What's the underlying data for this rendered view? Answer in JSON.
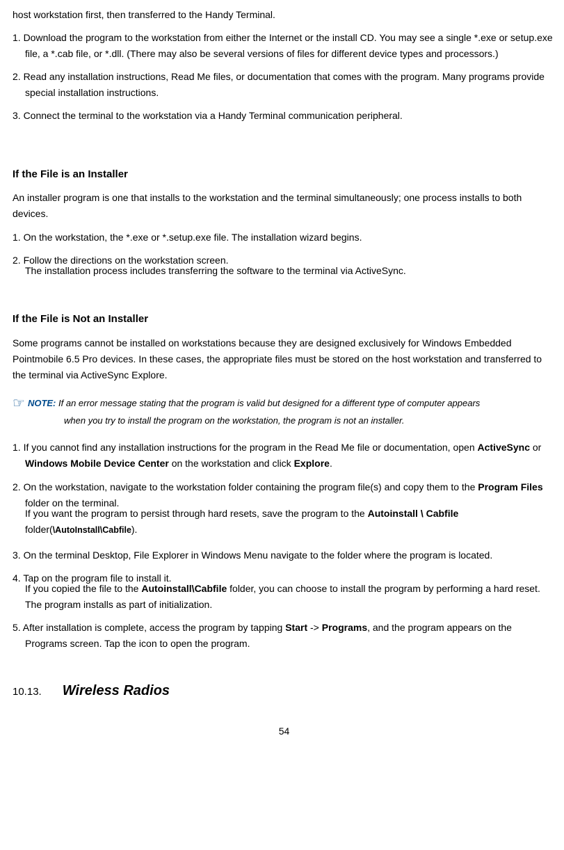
{
  "intro": {
    "p0": "host workstation first, then transferred to the Handy Terminal.",
    "li1": "1. Download the program to the workstation from either the Internet or the install CD. You may see a single *.exe or setup.exe file, a *.cab file, or *.dll. (There may also be several versions of files for different device types and processors.)",
    "li2": "2. Read any installation instructions, Read Me files, or documentation that comes with the program. Many programs provide special installation instructions.",
    "li3": "3. Connect the terminal to the workstation via a Handy Terminal communication peripheral."
  },
  "installer": {
    "heading": "If the File is an Installer",
    "p1": "An installer program is one that installs to the workstation and the terminal simultaneously; one process installs to both devices.",
    "li1": "1. On the workstation, the *.exe or *.setup.exe file. The installation wizard begins.",
    "li2a": "2. Follow the directions on the workstation screen.",
    "li2b": "The installation process includes transferring the software to the terminal via ActiveSync."
  },
  "notinstaller": {
    "heading": "If the File is Not an Installer",
    "p1": "Some programs cannot be installed on workstations because they are designed exclusively for Windows Embedded Pointmobile 6.5 Pro devices. In these cases, the appropriate files must be stored on the host workstation and transferred to the terminal via ActiveSync Explore."
  },
  "note": {
    "label": "NOTE:",
    "line1": " If an error message stating that the program is valid but designed for a different type of computer appears",
    "line2": "when you try to install the program on the workstation, the program is not an installer."
  },
  "steps": {
    "s1a": "1. If you cannot find any installation instructions for the program in the Read Me file or documentation, open ",
    "s1b": "ActiveSync",
    "s1c": " or ",
    "s1d": "Windows Mobile Device Center",
    "s1e": " on the workstation and click ",
    "s1f": "Explore",
    "s1g": ".",
    "s2a": "2. On the workstation, navigate to the workstation folder containing the program file(s) and copy them to the ",
    "s2b": "Program Files",
    "s2c": " folder on the terminal.",
    "s2d": "If you want the program to persist through hard resets, save the program to the ",
    "s2e": "Autoinstall \\ Cabfile",
    "s2f": " folder(",
    "s2g": "\\AutoInstall\\Cabfile",
    "s2h": ").",
    "s3": "3. On the terminal Desktop, File Explorer in Windows Menu navigate to the folder where the program is located.",
    "s4a": "4. Tap on the program file to install it.",
    "s4b": "If you copied the file to the ",
    "s4c": "Autoinstall\\Cabfile",
    "s4d": " folder, you can choose to install the program by performing a hard reset. The program installs as part of initialization.",
    "s5a": "5. After installation is complete, access the program by tapping ",
    "s5b": "Start",
    "s5c": " -> ",
    "s5d": "Programs",
    "s5e": ", and the program appears on the Programs screen. Tap the icon to open the program."
  },
  "section": {
    "number": "10.13.",
    "title": "Wireless Radios"
  },
  "page_number": "54"
}
